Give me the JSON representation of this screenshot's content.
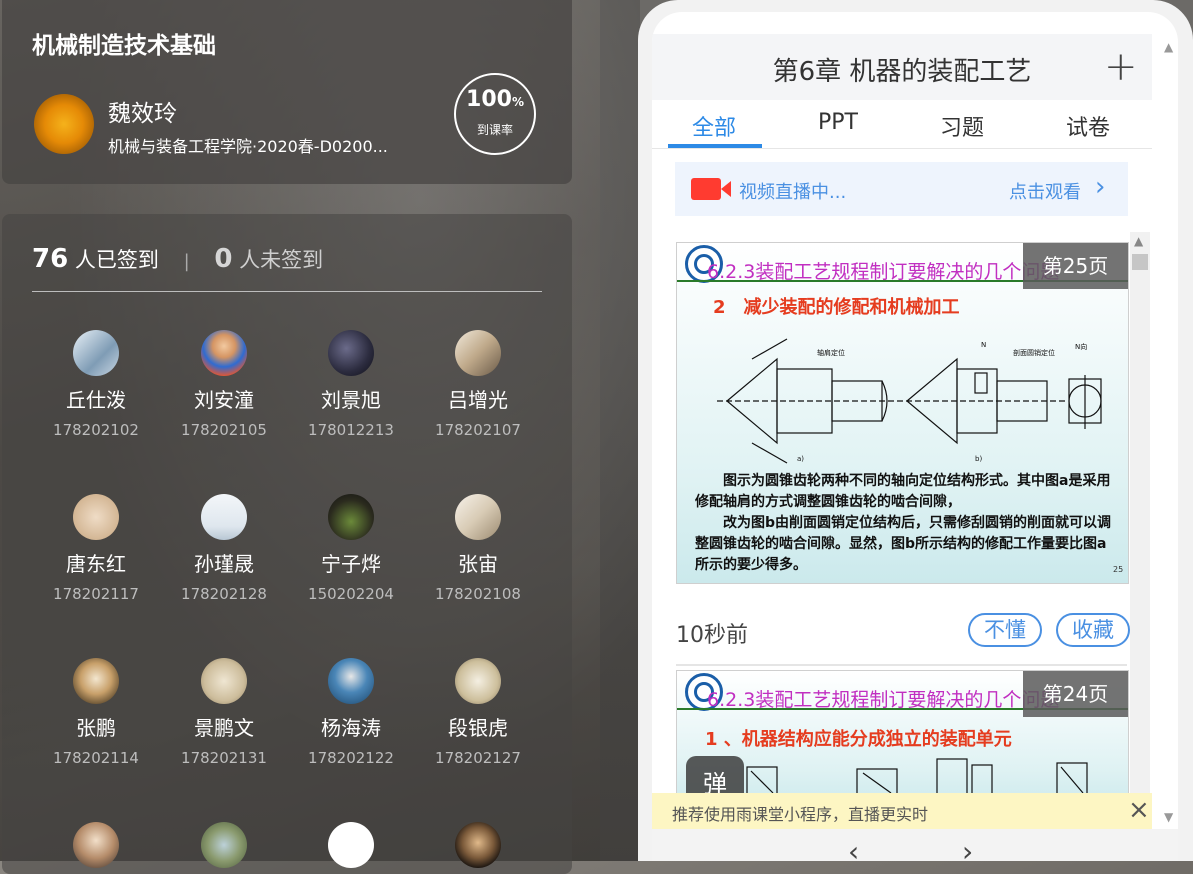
{
  "course": {
    "title": "机械制造技术基础",
    "teacher_name": "魏效玲",
    "teacher_dept": "机械与装备工程学院·2020春-D0200...",
    "rate_value": "100",
    "rate_unit": "%",
    "rate_label": "到课率"
  },
  "signin": {
    "signed_count": "76",
    "signed_label": "人已签到",
    "separator": "|",
    "unsigned_count": "0",
    "unsigned_label": "人未签到",
    "students": [
      {
        "name": "丘仕泼",
        "id": "178202102"
      },
      {
        "name": "刘安潼",
        "id": "178202105"
      },
      {
        "name": "刘景旭",
        "id": "178012213"
      },
      {
        "name": "吕增光",
        "id": "178202107"
      },
      {
        "name": "唐东红",
        "id": "178202117"
      },
      {
        "name": "孙瑾晟",
        "id": "178202128"
      },
      {
        "name": "宁子烨",
        "id": "150202204"
      },
      {
        "name": "张宙",
        "id": "178202108"
      },
      {
        "name": "张鹏",
        "id": "178202114"
      },
      {
        "name": "景鹏文",
        "id": "178202131"
      },
      {
        "name": "杨海涛",
        "id": "178202122"
      },
      {
        "name": "段银虎",
        "id": "178202127"
      }
    ]
  },
  "phone": {
    "chapter_title": "第6章 机器的装配工艺",
    "plus_icon": "+",
    "tabs": [
      "全部",
      "PPT",
      "习题",
      "试卷"
    ],
    "active_tab": "全部",
    "live_text": "视频直播中...",
    "live_watch": "点击观看",
    "chevron": "›",
    "slides": [
      {
        "heading": "6.2.3装配工艺规程制订要解决的几个问题",
        "page": "第25页",
        "subheading": "2　减少装配的修配和机械加工",
        "body": "　　图示为圆锥齿轮两种不同的轴向定位结构形式。其中图a是采用修配轴肩的方式调整圆锥齿轮的啮合间隙，\n　　改为图b由削面圆销定位结构后，只需修刮圆销的削面就可以调整圆锥齿轮的啮合间隙。显然，图b所示结构的修配工作量要比图a所示的要少得多。",
        "num": "25",
        "fig_labels": [
          "轴肩定位",
          "剖面圆销定位",
          "N向",
          "N",
          "a)",
          "b)"
        ]
      },
      {
        "heading": "6.2.3装配工艺规程制订要解决的几个问题",
        "page": "第24页",
        "subheading": "1 、机器结构应能分成独立的装配单元"
      }
    ],
    "post_time": "10秒前",
    "btn_dont_understand": "不懂",
    "btn_favorite": "收藏",
    "danmu_label": "弹",
    "notice": "推荐使用雨课堂小程序，直播更实时",
    "close_icon": "×",
    "nav_back": "‹",
    "nav_forward": "›"
  }
}
